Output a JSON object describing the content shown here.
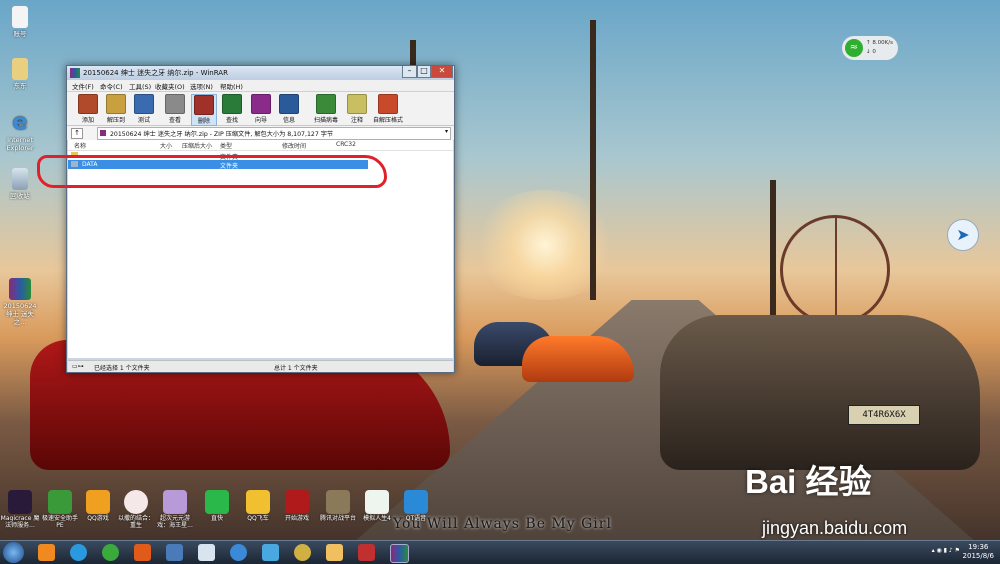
{
  "desktop_icons": [
    {
      "label": "账号"
    },
    {
      "label": "东东"
    },
    {
      "label": "Internet Explorer"
    },
    {
      "label": "回收站"
    },
    {
      "label": "20150624 绅士 迷失之..."
    }
  ],
  "net_widget": {
    "speed1": "↑ 8.00K/s",
    "speed2": "↓ 0"
  },
  "window": {
    "title": "20150624 绅士 迷失之牙 纳尔.zip - WinRAR",
    "menus": [
      "文件(F)",
      "命令(C)",
      "工具(S)",
      "收藏夹(O)",
      "选项(N)",
      "帮助(H)"
    ],
    "toolbar": [
      {
        "label": "添加",
        "icon": "add-archive-icon",
        "color": "#b04a2a"
      },
      {
        "label": "解压到",
        "icon": "extract-to-icon",
        "color": "#c8a040"
      },
      {
        "label": "测试",
        "icon": "test-icon",
        "color": "#3a6ab0"
      },
      {
        "label": "查看",
        "icon": "view-icon",
        "color": "#8a8a8a"
      },
      {
        "label": "删除",
        "icon": "delete-icon",
        "color": "#a0302a"
      },
      {
        "label": "查找",
        "icon": "find-icon",
        "color": "#2a7a3a"
      },
      {
        "label": "向导",
        "icon": "wizard-icon",
        "color": "#8a2a8a"
      },
      {
        "label": "信息",
        "icon": "info-icon",
        "color": "#2a5a9a"
      },
      {
        "label": "扫描病毒",
        "icon": "scan-virus-icon",
        "color": "#3a8a3a"
      },
      {
        "label": "注释",
        "icon": "comment-icon",
        "color": "#c8c060"
      },
      {
        "label": "自解压格式",
        "icon": "sfx-icon",
        "color": "#c84a2a"
      }
    ],
    "address": "20150624 绅士 迷失之牙 纳尔.zip - ZIP 压缩文件, 解包大小为 8,107,127 字节",
    "columns": [
      "名称",
      "大小",
      "压缩后大小",
      "类型",
      "修改时间",
      "CRC32"
    ],
    "rows": [
      {
        "name": "..",
        "type": "文件夹",
        "selected": false
      },
      {
        "name": "DATA",
        "type": "文件夹",
        "selected": true
      }
    ],
    "status_left": "已经选择 1 个文件夹",
    "status_right": "总计 1 个文件夹"
  },
  "bottom_icons": [
    {
      "label": "Magicrace 魔法师服务..."
    },
    {
      "label": "极速安全助手PE"
    },
    {
      "label": "QQ游戏"
    },
    {
      "label": "以撒的结合：重生"
    },
    {
      "label": "超次元元游戏：海王星..."
    },
    {
      "label": "直快"
    },
    {
      "label": "QQ飞车"
    },
    {
      "label": "开始游戏"
    },
    {
      "label": "腾讯对战平台"
    },
    {
      "label": "模拟人生4"
    },
    {
      "label": "QT语音"
    }
  ],
  "lyric": "You Will Always Be My Girl",
  "watermark": {
    "logo": "Bai 经验",
    "url": "jingyan.baidu.com"
  },
  "plate": "4T4R6X6X",
  "clock": {
    "time": "19:36",
    "date": "2015/8/6"
  }
}
